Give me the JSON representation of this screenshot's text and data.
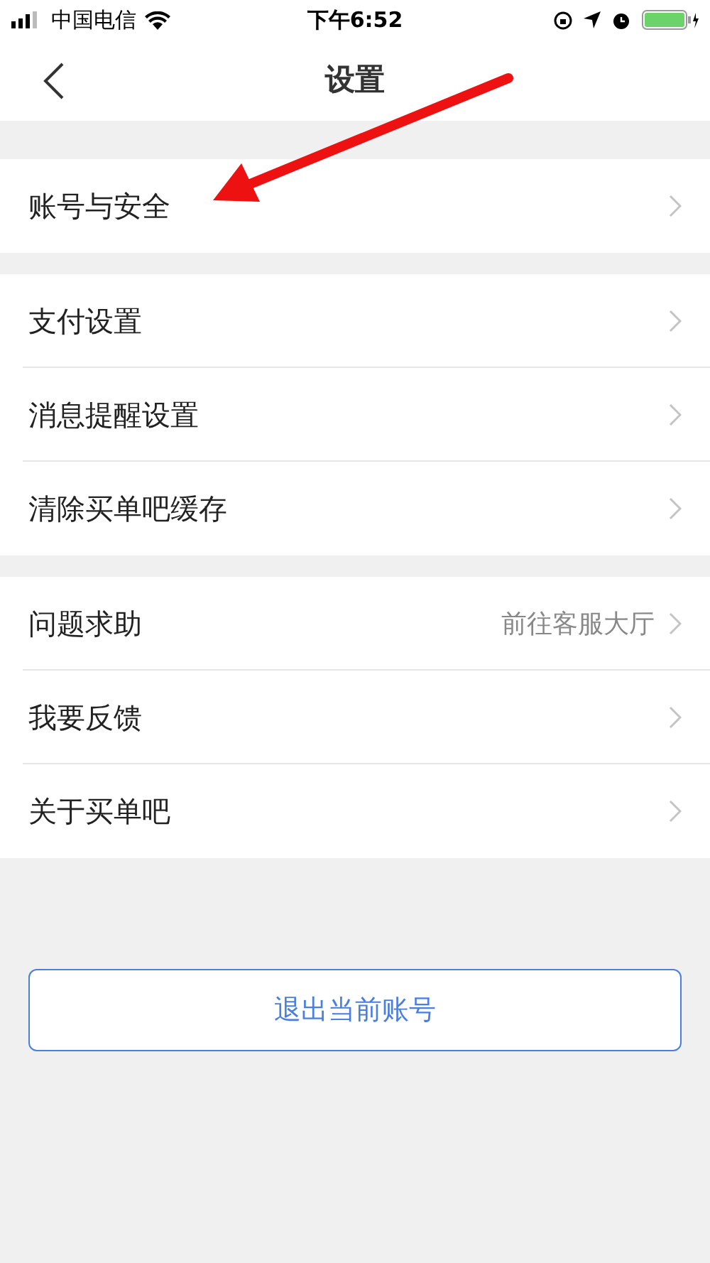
{
  "status_bar": {
    "carrier": "中国电信",
    "time": "下午6:52"
  },
  "nav": {
    "title": "设置"
  },
  "groups": [
    {
      "rows": [
        {
          "label": "账号与安全"
        }
      ]
    },
    {
      "rows": [
        {
          "label": "支付设置"
        },
        {
          "label": "消息提醒设置"
        },
        {
          "label": "清除买单吧缓存"
        }
      ]
    },
    {
      "rows": [
        {
          "label": "问题求助",
          "detail": "前往客服大厅"
        },
        {
          "label": "我要反馈"
        },
        {
          "label": "关于买单吧"
        }
      ]
    }
  ],
  "logout_button": "退出当前账号"
}
